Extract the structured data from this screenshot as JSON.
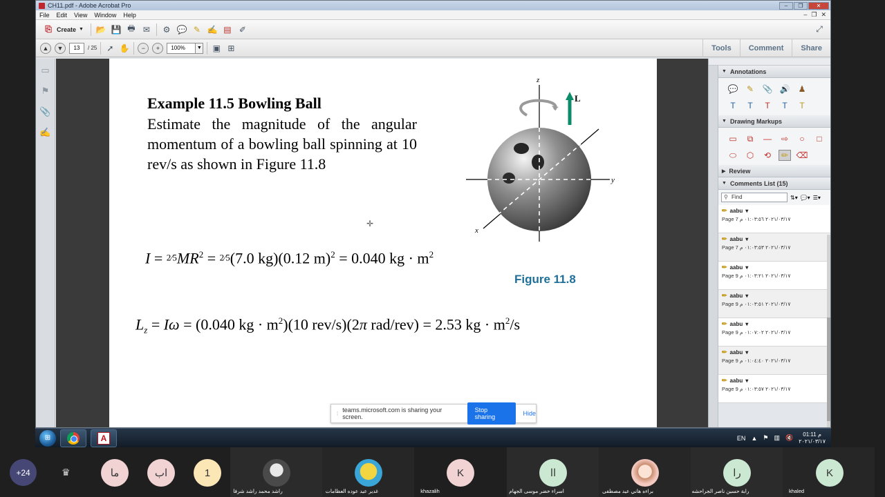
{
  "window": {
    "title": "CH11.pdf - Adobe Acrobat Pro",
    "menu": [
      "File",
      "Edit",
      "View",
      "Window",
      "Help"
    ]
  },
  "toolbar": {
    "create_label": "Create",
    "page_current": "13",
    "page_total": "/ 25",
    "zoom": "100%",
    "tabs": [
      "Tools",
      "Comment",
      "Share"
    ]
  },
  "document": {
    "example_title": "Example 11.5 Bowling Ball",
    "example_body": "Estimate the magnitude of the angular momentum of a bowling ball spinning at 10 rev/s as shown in Figure  11.8",
    "figure_caption": "Figure 11.8",
    "axis_z": "z",
    "axis_y": "y",
    "axis_x": "x",
    "vector_label": "L"
  },
  "share_bar": {
    "text": "teams.microsoft.com is sharing your screen.",
    "stop_label": "Stop sharing",
    "hide_label": "Hide"
  },
  "right_pane": {
    "annotations_title": "Annotations",
    "drawing_title": "Drawing Markups",
    "review_title": "Review",
    "comments_title": "Comments List (15)",
    "find_placeholder": "Find",
    "comments": [
      {
        "author": "aabu",
        "meta": "Page 7 ٢٠٢١/٠٣/١٧ ٠١:٠٣:٥٦ م"
      },
      {
        "author": "aabu",
        "meta": "Page 7 ٢٠٢١/٠٣/١٧ ٠١:٠٣:٥٣ م"
      },
      {
        "author": "aabu",
        "meta": "Page 9 ٢٠٢١/٠٣/١٧ ٠١:٠٣:٢١ م"
      },
      {
        "author": "aabu",
        "meta": "Page 9 ٢٠٢١/٠٣/١٧ ٠١:٠٣:٥١ م"
      },
      {
        "author": "aabu",
        "meta": "Page 9 ٢٠٢١/٠٣/١٧ ٠١:٠٧:٠٢ م"
      },
      {
        "author": "aabu",
        "meta": "Page 9 ٢٠٢١/٠٣/١٧ ٠١:٠٤:٤٠ م"
      },
      {
        "author": "aabu",
        "meta": "Page 9 ٢٠٢١/٠٣/١٧ ٠١:٠٣:٥٧ م"
      }
    ]
  },
  "taskbar": {
    "language": "EN",
    "time": "01:11 م",
    "date": "٢٠٢١/٠٣/١٧"
  },
  "participants": {
    "more_count": "+24",
    "people": [
      {
        "initials": "ما",
        "name": "",
        "color": "#f1d3d3"
      },
      {
        "initials": "اب",
        "name": "",
        "color": "#f1d3d3"
      },
      {
        "initials": "1",
        "name": "",
        "color": "#fbe7b5"
      },
      {
        "initials": "",
        "name": "راشد محمد راشد شرفا",
        "color": "#5a5a5a"
      },
      {
        "initials": "",
        "name": "غدير عيد عوده العظامات",
        "color": "#3aa6d8"
      },
      {
        "initials": "K",
        "name": "khazalih",
        "color": "#f1d3d3"
      },
      {
        "initials": "اا",
        "name": "اسراء خضر موسى الجهام",
        "color": "#cbe8d2"
      },
      {
        "initials": "",
        "name": "براءه هاني عيد مصطفى",
        "color": "#f3c9c0"
      },
      {
        "initials": "را",
        "name": "رابة حسين ناصر الجراحشه",
        "color": "#cbe8d2"
      },
      {
        "initials": "K",
        "name": "khaled",
        "color": "#cbe8d2"
      }
    ]
  }
}
